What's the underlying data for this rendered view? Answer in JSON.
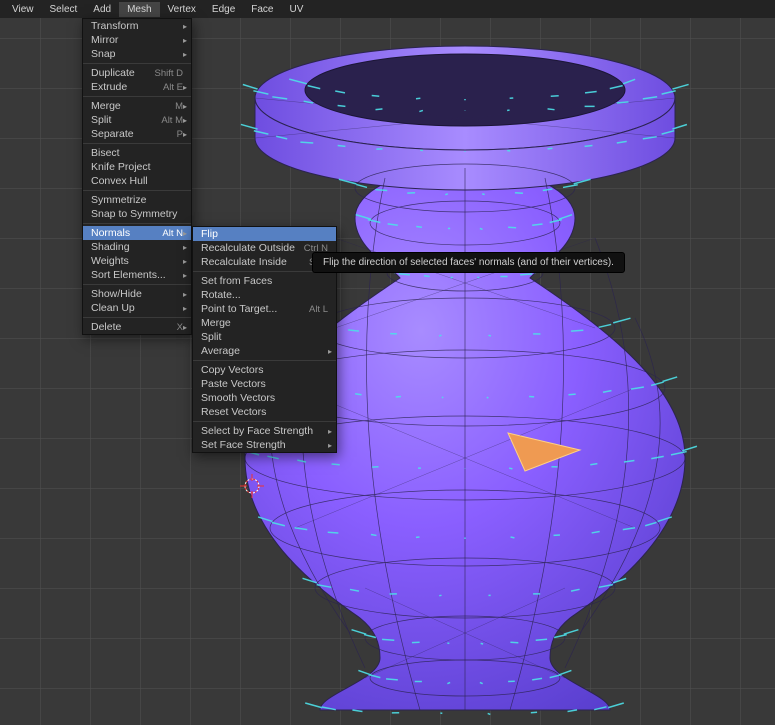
{
  "menubar": {
    "items": [
      {
        "label": "View"
      },
      {
        "label": "Select"
      },
      {
        "label": "Add"
      },
      {
        "label": "Mesh",
        "active": true
      },
      {
        "label": "Vertex"
      },
      {
        "label": "Edge"
      },
      {
        "label": "Face"
      },
      {
        "label": "UV"
      }
    ]
  },
  "menu_mesh": {
    "groups": [
      [
        {
          "label": "Transform",
          "sub": true
        },
        {
          "label": "Mirror",
          "sub": true
        },
        {
          "label": "Snap",
          "sub": true
        }
      ],
      [
        {
          "label": "Duplicate",
          "shortcut": "Shift D"
        },
        {
          "label": "Extrude",
          "shortcut": "Alt E",
          "sub": true
        }
      ],
      [
        {
          "label": "Merge",
          "shortcut": "M",
          "sub": true
        },
        {
          "label": "Split",
          "shortcut": "Alt M",
          "sub": true
        },
        {
          "label": "Separate",
          "shortcut": "P",
          "sub": true
        }
      ],
      [
        {
          "label": "Bisect"
        },
        {
          "label": "Knife Project"
        },
        {
          "label": "Convex Hull"
        }
      ],
      [
        {
          "label": "Symmetrize"
        },
        {
          "label": "Snap to Symmetry"
        }
      ],
      [
        {
          "label": "Normals",
          "shortcut": "Alt N",
          "sub": true,
          "highlight": true
        },
        {
          "label": "Shading",
          "sub": true
        },
        {
          "label": "Weights",
          "sub": true
        },
        {
          "label": "Sort Elements...",
          "sub": true
        }
      ],
      [
        {
          "label": "Show/Hide",
          "sub": true
        },
        {
          "label": "Clean Up",
          "sub": true
        }
      ],
      [
        {
          "label": "Delete",
          "shortcut": "X",
          "sub": true
        }
      ]
    ]
  },
  "menu_normals": {
    "groups": [
      [
        {
          "label": "Flip",
          "highlight": true
        },
        {
          "label": "Recalculate Outside",
          "shortcut": "Ctrl N"
        },
        {
          "label": "Recalculate Inside",
          "shortcut": "Shift"
        }
      ],
      [
        {
          "label": "Set from Faces"
        },
        {
          "label": "Rotate..."
        },
        {
          "label": "Point to Target...",
          "shortcut": "Alt L"
        },
        {
          "label": "Merge"
        },
        {
          "label": "Split"
        },
        {
          "label": "Average",
          "sub": true
        }
      ],
      [
        {
          "label": "Copy Vectors"
        },
        {
          "label": "Paste Vectors"
        },
        {
          "label": "Smooth Vectors"
        },
        {
          "label": "Reset Vectors"
        }
      ],
      [
        {
          "label": "Select by Face Strength",
          "sub": true
        },
        {
          "label": "Set Face Strength",
          "sub": true
        }
      ]
    ]
  },
  "tooltip": {
    "text": "Flip the direction of selected faces' normals (and of their vertices)."
  },
  "viewport": {
    "object_name": "vase",
    "selected_face_color": "#ef9a52",
    "normals_display_color": "#4de0e8",
    "mesh_material_color": "#8a5fff",
    "wireframe_color": "#2b2350"
  }
}
